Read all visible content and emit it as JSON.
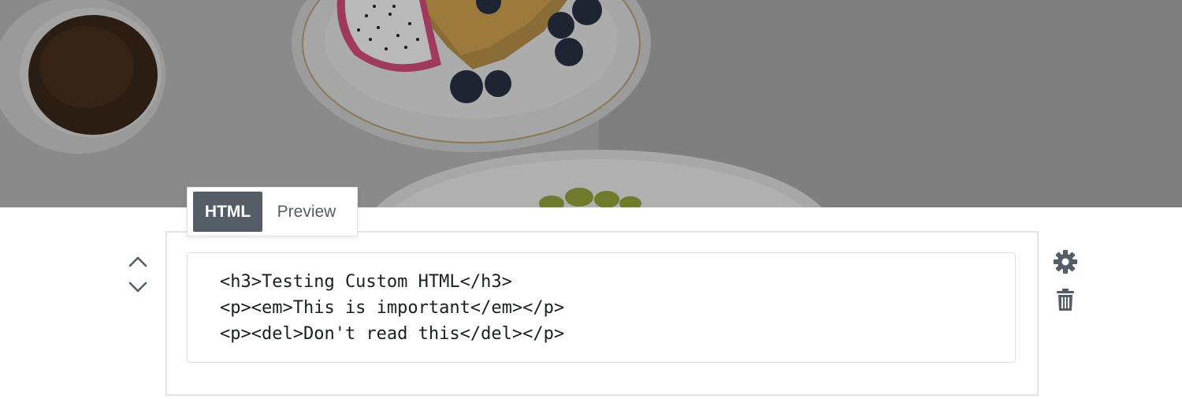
{
  "cover": {
    "image_description": "",
    "overlay_color": "#808080"
  },
  "block_toolbar": {
    "tabs": [
      {
        "label": "HTML",
        "active": true
      },
      {
        "label": "Preview",
        "active": false
      }
    ]
  },
  "editor": {
    "lines": [
      "<h3>Testing Custom HTML</h3>",
      "<p><em>This is important</em></p>",
      "<p><del>Don't read this</del></p>"
    ]
  },
  "icons": {
    "move_up": "chevron-up-icon",
    "move_down": "chevron-down-icon",
    "settings": "gear-icon",
    "delete": "trash-icon"
  },
  "colors": {
    "active_tab_bg": "#555d66",
    "icon_color": "#555d66",
    "border": "#e2e4e7"
  }
}
